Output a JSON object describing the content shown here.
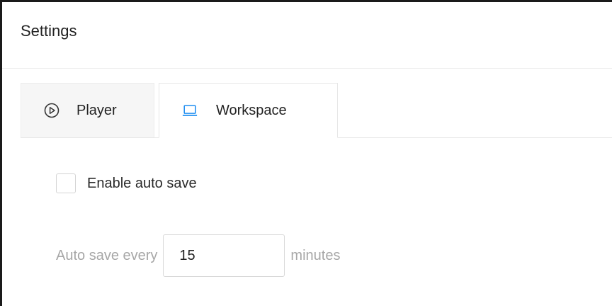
{
  "window": {
    "title": "Settings"
  },
  "tabs": [
    {
      "label": "Player",
      "icon": "play-circle-icon",
      "active": false
    },
    {
      "label": "Workspace",
      "icon": "laptop-icon",
      "active": true
    }
  ],
  "workspace": {
    "auto_save": {
      "label": "Enable auto save",
      "checked": false
    },
    "interval": {
      "prefix": "Auto save every",
      "value": "15",
      "suffix": "minutes"
    }
  },
  "colors": {
    "accent": "#1f8ef1",
    "border": "#1a1a1a",
    "muted_text": "#a7a7a7"
  }
}
